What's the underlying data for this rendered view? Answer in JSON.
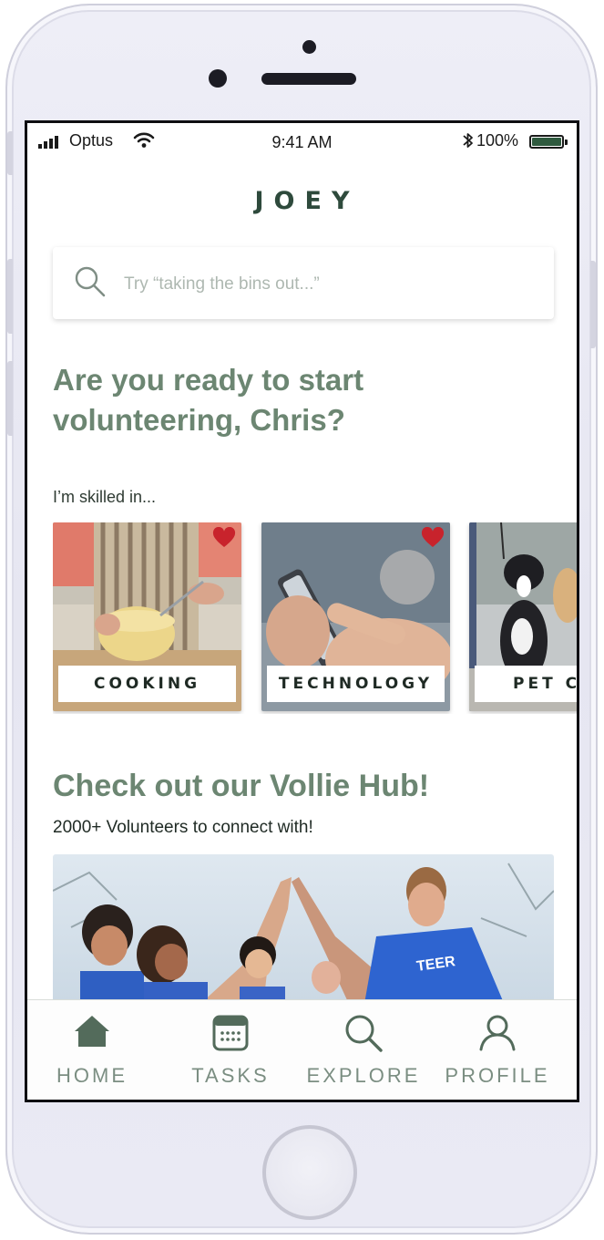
{
  "status_bar": {
    "carrier": "Optus",
    "time": "9:41 AM",
    "battery": "100%"
  },
  "app": {
    "logo": "JOEY"
  },
  "search": {
    "placeholder": "Try “taking the bins out...”"
  },
  "greeting": {
    "line1": "Are you ready to start",
    "line2": "volunteering, Chris?"
  },
  "skills": {
    "heading": "I’m skilled in...",
    "items": [
      {
        "label": "COOKING",
        "favorited": true,
        "image": "cooking-photo"
      },
      {
        "label": "TECHNOLOGY",
        "favorited": true,
        "image": "technology-photo"
      },
      {
        "label": "PET C",
        "favorited": false,
        "image": "pet-care-photo"
      }
    ]
  },
  "hub": {
    "title": "Check out our Vollie Hub!",
    "subtitle": "2000+ Volunteers to connect with!",
    "image": "volunteers-high-five-photo"
  },
  "tabs": [
    {
      "label": "HOME",
      "icon": "home-icon"
    },
    {
      "label": "TASKS",
      "icon": "calendar-icon"
    },
    {
      "label": "EXPLORE",
      "icon": "search-icon"
    },
    {
      "label": "PROFILE",
      "icon": "person-icon"
    }
  ],
  "colors": {
    "brand_green": "#6c8672",
    "logo_dark": "#2e4a3c",
    "heart_red": "#c8232c",
    "tab_icon": "#536b5b"
  }
}
